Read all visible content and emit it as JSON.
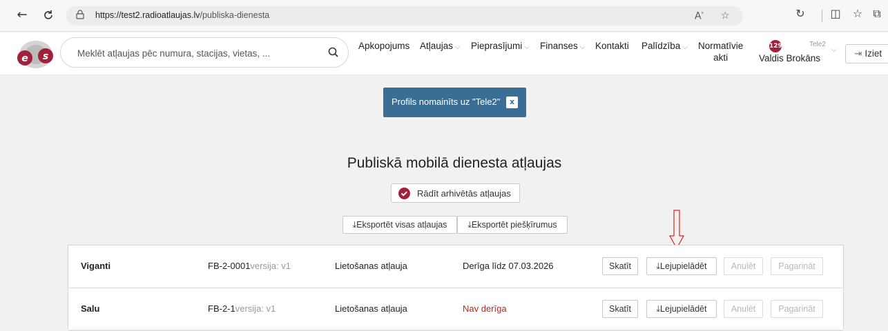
{
  "browser": {
    "url_domain": "https://test2.radioatlaujas.lv",
    "url_path": "/publiska-dienesta"
  },
  "header": {
    "search_placeholder": "Meklēt atļaujas pēc numura, stacijas, vietas, ...",
    "nav": [
      {
        "label": "Apkopojums",
        "dropdown": false
      },
      {
        "label": "Atļaujas",
        "dropdown": true
      },
      {
        "label": "Pieprasījumi",
        "dropdown": true
      },
      {
        "label": "Finanses",
        "dropdown": true
      },
      {
        "label": "Kontakti",
        "dropdown": false
      },
      {
        "label": "Palīdzība",
        "dropdown": true
      }
    ],
    "nav_normative_line1": "Normatīvie",
    "nav_normative_line2": "akti",
    "user_badge": "129",
    "user_org": "Tele2",
    "user_name": "Valdis Brokāns",
    "logout_label": "Iziet"
  },
  "toast": {
    "message": "Profils nomainīts uz \"Tele2\"",
    "close_label": "x"
  },
  "main": {
    "title": "Publiskā mobilā dienesta atļaujas",
    "archive_toggle_label": "Rādīt arhivētās atļaujas",
    "export_all_label": "Eksportēt visas atļaujas",
    "export_assign_label": "Eksportēt piešķīrumus"
  },
  "rows": [
    {
      "name": "Viganti",
      "number": "FB-2-0001",
      "version": "versija: v1",
      "type": "Lietošanas atļauja",
      "status": "Derīga līdz 07.03.2026",
      "status_valid": true
    },
    {
      "name": "Salu",
      "number": "FB-2-1",
      "version": "versija: v1",
      "type": "Lietošanas atļauja",
      "status": "Nav derīga",
      "status_valid": false
    }
  ],
  "row_actions": {
    "view": "Skatīt",
    "download": "Lejupielādēt",
    "cancel": "Anulēt",
    "extend": "Pagarināt"
  },
  "colors": {
    "accent": "#a1213a",
    "toast_bg": "#3a6e94",
    "invalid": "#b3261e",
    "marker": "#e02020"
  }
}
